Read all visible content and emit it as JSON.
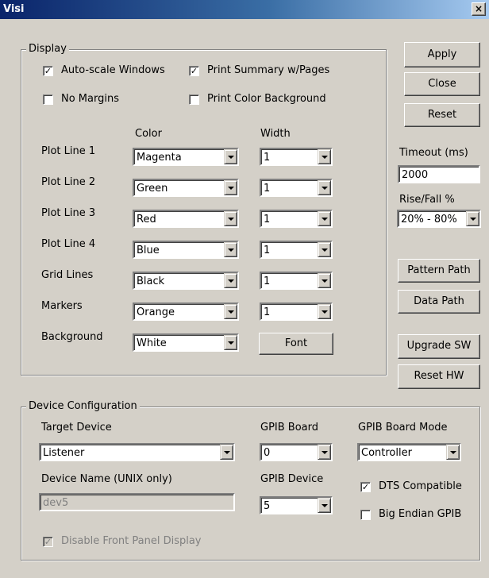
{
  "window": {
    "title": "Visi",
    "close_glyph": "×"
  },
  "display": {
    "legend": "Display",
    "checkboxes": {
      "auto_scale": {
        "label": "Auto-scale Windows",
        "checked": true
      },
      "print_summary": {
        "label": "Print Summary w/Pages",
        "checked": true
      },
      "no_margins": {
        "label": "No Margins",
        "checked": false
      },
      "print_color_bg": {
        "label": "Print Color Background",
        "checked": false
      }
    },
    "color_header": "Color",
    "width_header": "Width",
    "rows": [
      {
        "label": "Plot Line 1",
        "color": "Magenta",
        "width": "1"
      },
      {
        "label": "Plot Line 2",
        "color": "Green",
        "width": "1"
      },
      {
        "label": "Plot Line 3",
        "color": "Red",
        "width": "1"
      },
      {
        "label": "Plot Line 4",
        "color": "Blue",
        "width": "1"
      },
      {
        "label": "Grid Lines",
        "color": "Black",
        "width": "1"
      },
      {
        "label": "Markers",
        "color": "Orange",
        "width": "1"
      },
      {
        "label": "Background",
        "color": "White"
      }
    ],
    "font_button": "Font"
  },
  "side": {
    "apply": "Apply",
    "close": "Close",
    "reset": "Reset",
    "timeout_label": "Timeout (ms)",
    "timeout_value": "2000",
    "risefall_label": "Rise/Fall %",
    "risefall_value": "20% - 80%",
    "pattern_path": "Pattern Path",
    "data_path": "Data Path",
    "upgrade_sw": "Upgrade SW",
    "reset_hw": "Reset HW"
  },
  "device": {
    "legend": "Device Configuration",
    "target_label": "Target Device",
    "target_value": "Listener",
    "gpib_board_label": "GPIB Board",
    "gpib_board_value": "0",
    "gpib_mode_label": "GPIB Board Mode",
    "gpib_mode_value": "Controller",
    "device_name_label": "Device Name (UNIX only)",
    "device_name_value": "dev5",
    "gpib_device_label": "GPIB Device",
    "gpib_device_value": "5",
    "dts_compatible": {
      "label": "DTS Compatible",
      "checked": true
    },
    "big_endian": {
      "label": "Big Endian GPIB",
      "checked": false
    },
    "disable_front_panel": {
      "label": "Disable Front Panel Display",
      "checked": true
    }
  }
}
